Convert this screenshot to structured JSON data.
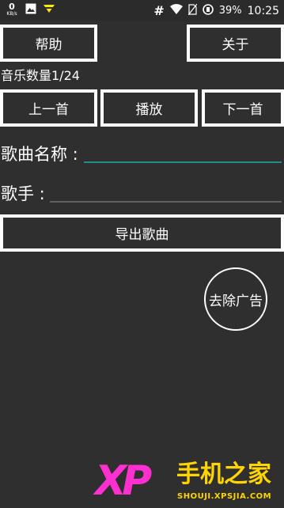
{
  "status_bar": {
    "net_speed_value": "0",
    "net_speed_unit": "KB/s",
    "hash_symbol": "#",
    "battery_percent": "39%",
    "time": "10:25"
  },
  "top_buttons": {
    "help": "帮助",
    "about": "关于"
  },
  "music_count": "音乐数量1/24",
  "controls": {
    "prev": "上一首",
    "play": "播放",
    "next": "下一首"
  },
  "fields": {
    "song_name_label": "歌曲名称 :",
    "song_name_value": "",
    "singer_label": "歌手 :",
    "singer_value": ""
  },
  "export_button": "导出歌曲",
  "remove_ads_button": "去除广告",
  "watermark": {
    "logo": "XP",
    "text": "手机之家",
    "url": "SHOUJI.XPSJIA.COM"
  },
  "colors": {
    "background": "#2f2f2f",
    "focused_underline": "#1f8f8a",
    "watermark_pink": "#ff2fd0",
    "watermark_yellow": "#ffd400"
  }
}
